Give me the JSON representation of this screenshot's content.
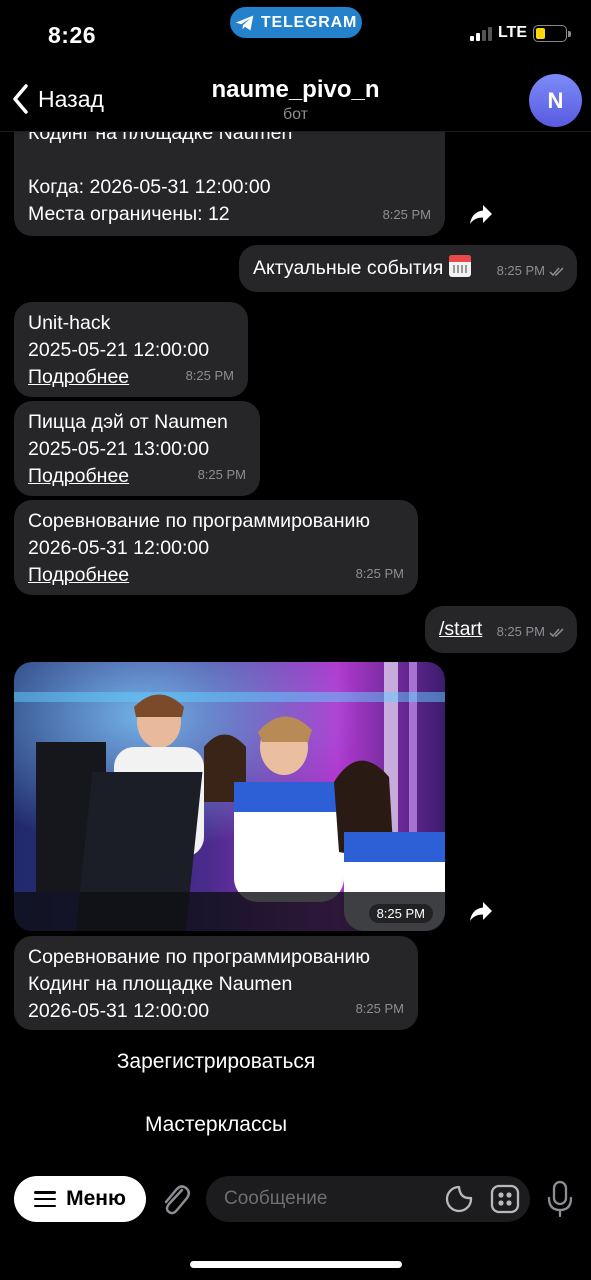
{
  "status_bar": {
    "time": "8:26",
    "app_pill": "TELEGRAM",
    "network": "LTE"
  },
  "header": {
    "back_label": "Назад",
    "title": "naume_pivo_n",
    "subtitle": "бот",
    "avatar_letter": "N"
  },
  "messages": {
    "m1": {
      "lines": [
        "Кодинг на площадке Naumen",
        "",
        "Когда: 2026-05-31 12:00:00",
        "Места ограничены: 12"
      ],
      "time": "8:25 PM"
    },
    "m2": {
      "text": "Актуальные события",
      "time": "8:25 PM"
    },
    "m3": {
      "lines": [
        "Unit-hack",
        "2025-05-21 12:00:00"
      ],
      "link": "Подробнее",
      "time": "8:25 PM"
    },
    "m4": {
      "lines": [
        "Пицца дэй от Naumen",
        "2025-05-21 13:00:00"
      ],
      "link": "Подробнее",
      "time": "8:25 PM"
    },
    "m5": {
      "lines": [
        "Соревнование по программированию",
        "2026-05-31 12:00:00"
      ],
      "link": "Подробнее",
      "time": "8:25 PM"
    },
    "m6": {
      "text": "/start",
      "time": "8:25 PM"
    },
    "photo": {
      "time": "8:25 PM"
    },
    "m7": {
      "lines": [
        "Соревнование по программированию",
        "Кодинг на площадке Naumen",
        "2026-05-31 12:00:00"
      ],
      "time": "8:25 PM"
    }
  },
  "keyboard": {
    "register": "Зарегистрироваться",
    "masterclasses": "Мастерклассы"
  },
  "input": {
    "menu_label": "Меню",
    "placeholder": "Сообщение"
  },
  "colors": {
    "bubble": "#262628",
    "telegram_blue": "#2481cc",
    "avatar": "#6b6bef"
  }
}
